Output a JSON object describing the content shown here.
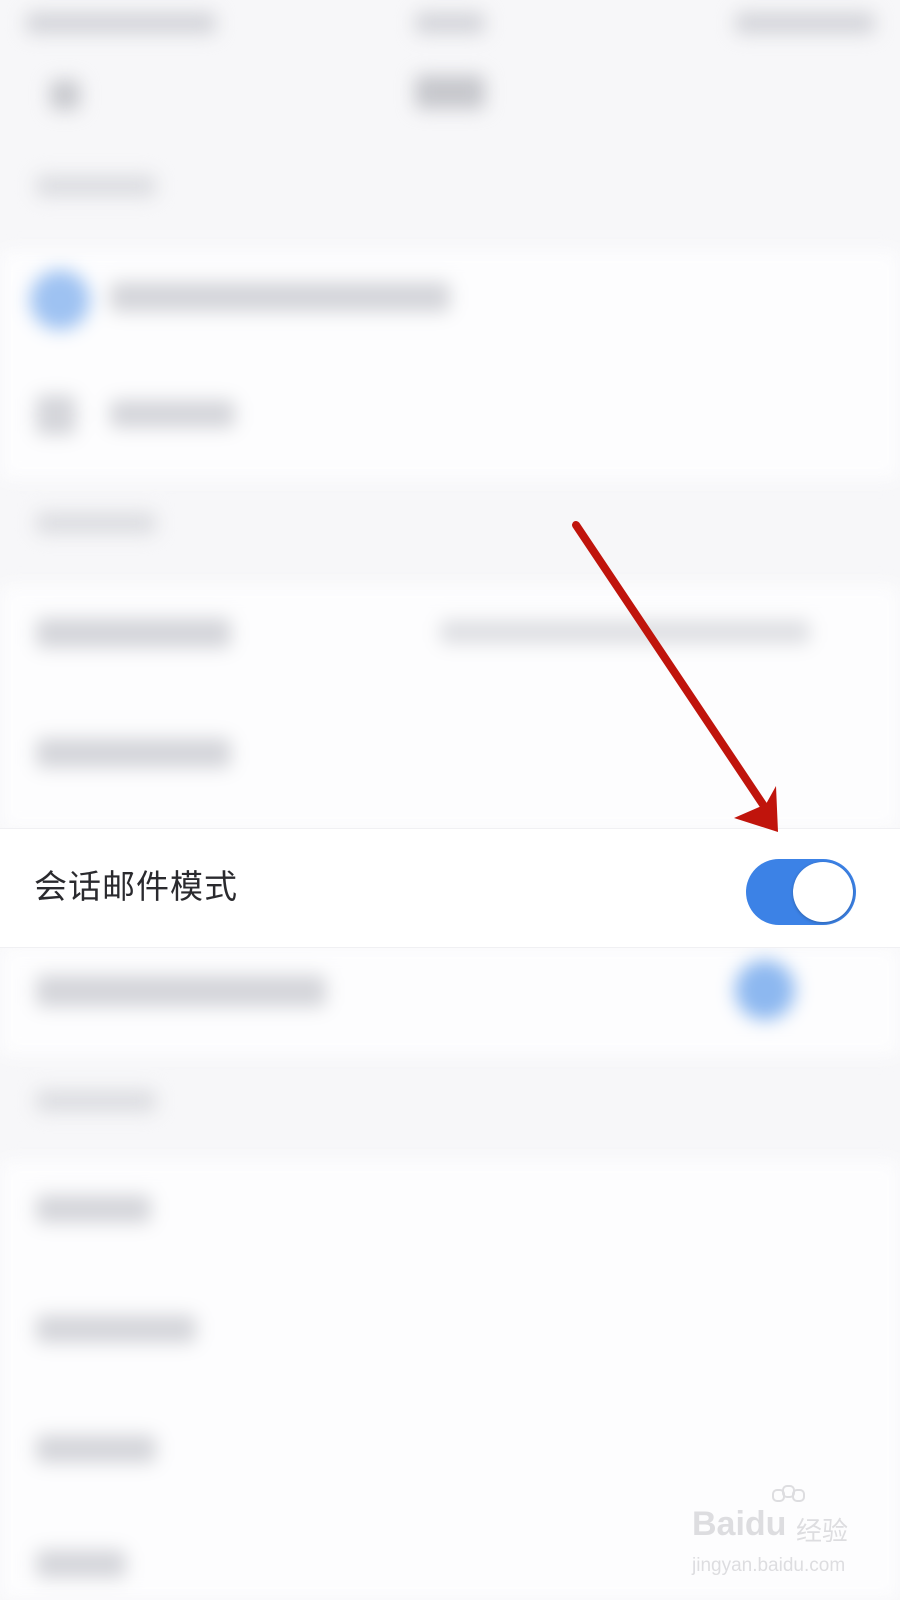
{
  "setting_row": {
    "label": "会话邮件模式",
    "toggle_state": "on",
    "toggle_color": "#3c82e6"
  },
  "annotation": {
    "arrow_color": "#c0140c"
  },
  "watermark": {
    "logo": "Baidu",
    "cn": "经验",
    "url": "jingyan.baidu.com"
  }
}
